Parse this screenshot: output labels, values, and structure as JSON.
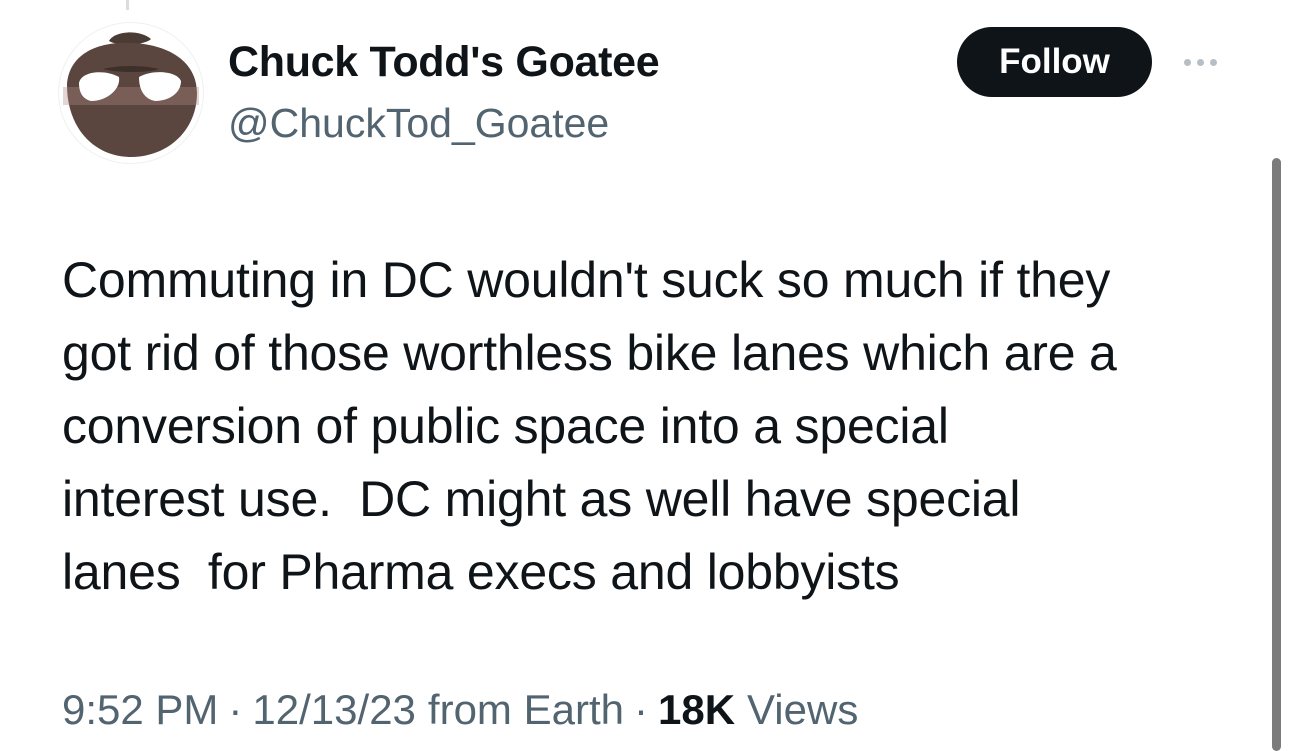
{
  "author": {
    "display_name": "Chuck Todd's Goatee",
    "handle": "@ChuckTod_Goatee"
  },
  "actions": {
    "follow_label": "Follow",
    "more_icon": "more-horizontal-icon"
  },
  "tweet": {
    "lines": [
      "Commuting in DC wouldn't suck so much if they",
      "got rid of those worthless bike lanes which are a",
      "conversion of public space into a special",
      "interest use.  DC might as well have special",
      "lanes  for Pharma execs and lobbyists"
    ]
  },
  "meta": {
    "time": "9:52 PM",
    "separator": "·",
    "date": "12/13/23",
    "source": "from Earth",
    "views_count": "18K",
    "views_label": "Views"
  },
  "colors": {
    "text_primary": "#0f1419",
    "text_secondary": "#536471",
    "button_bg": "#0f1419",
    "button_text": "#ffffff"
  }
}
